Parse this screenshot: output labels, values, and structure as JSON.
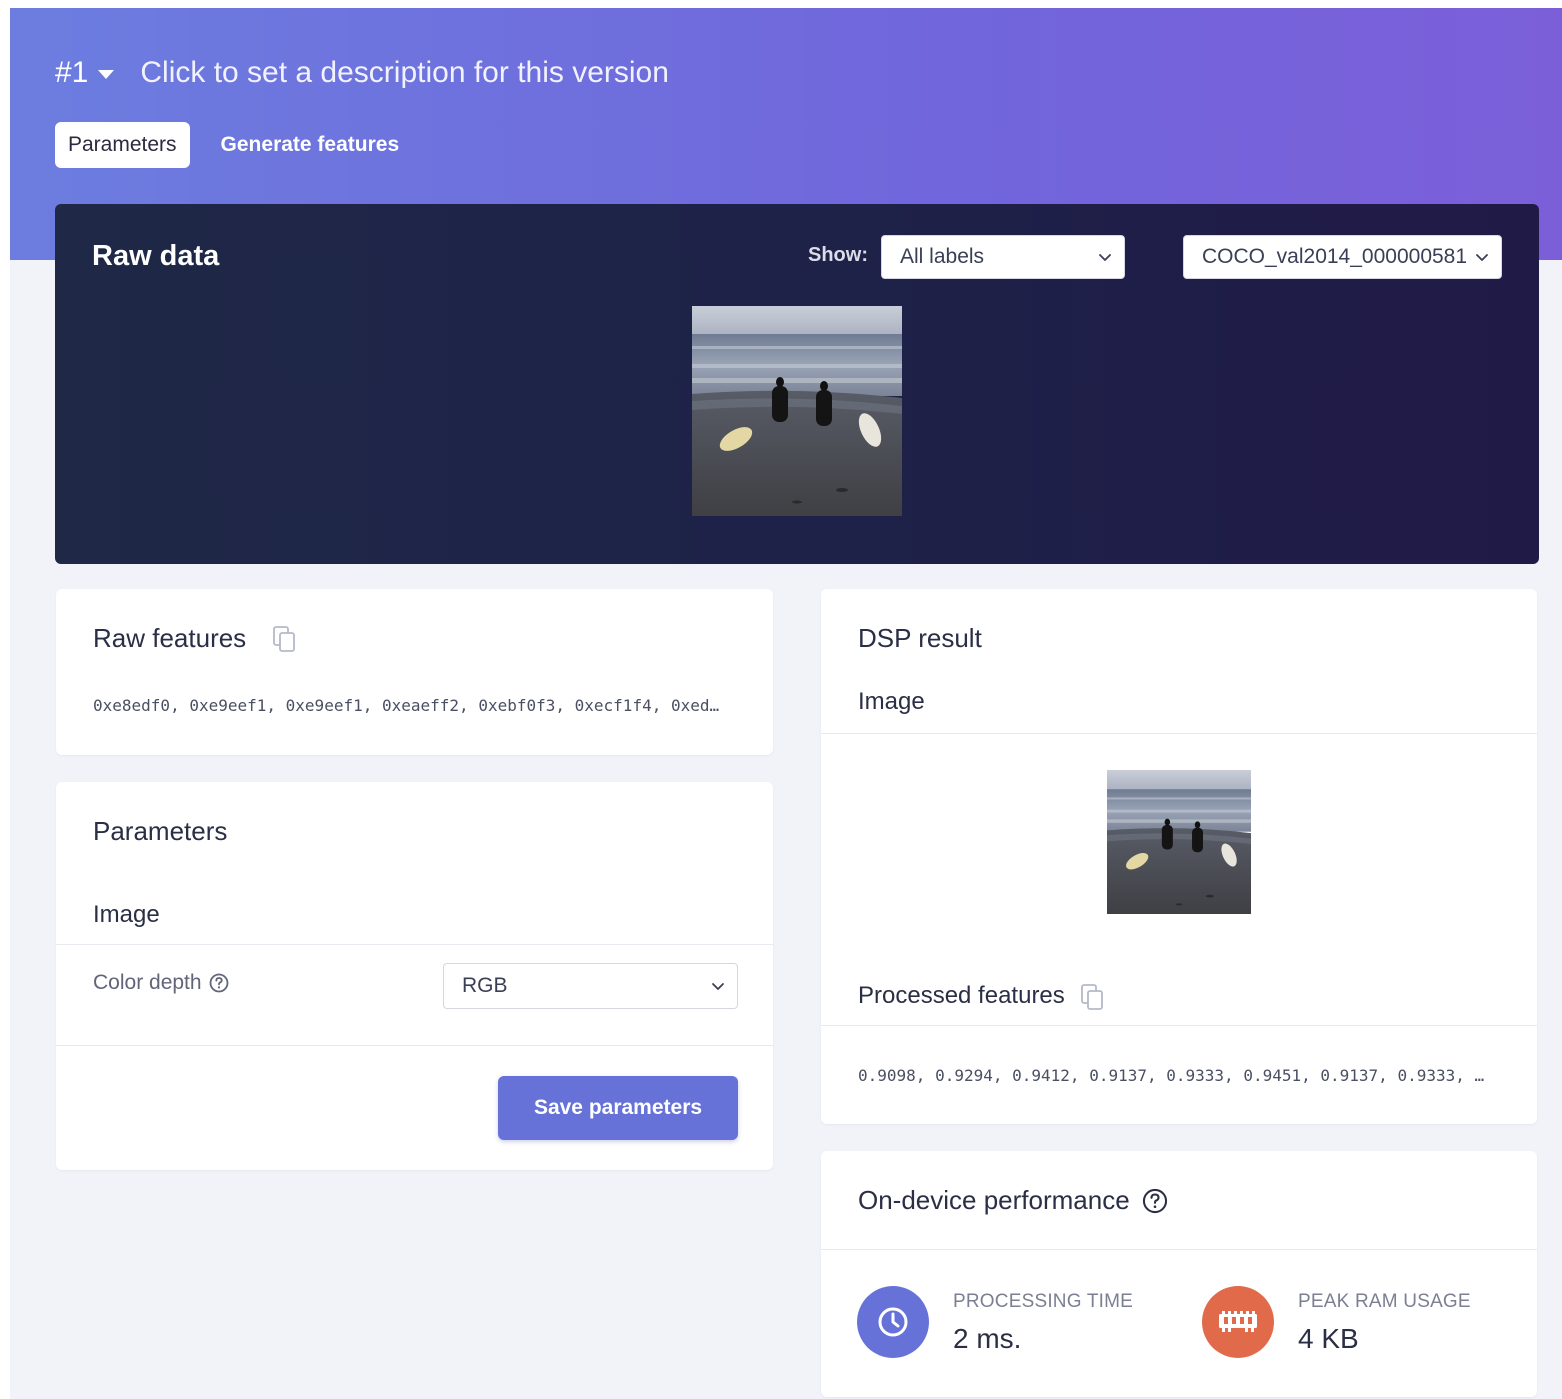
{
  "header": {
    "version": "#1",
    "description_placeholder": "Click to set a description for this version",
    "tabs": [
      {
        "label": "Parameters",
        "active": true
      },
      {
        "label": "Generate features",
        "active": false
      }
    ]
  },
  "raw_data": {
    "title": "Raw data",
    "show_label": "Show:",
    "label_filter": "All labels",
    "sample": "COCO_val2014_000000581"
  },
  "raw_features": {
    "title": "Raw features",
    "values": "0xe8edf0, 0xe9eef1, 0xe9eef1, 0xeaeff2, 0xebf0f3, 0xecf1f4, 0xed…"
  },
  "parameters": {
    "title": "Parameters",
    "section": "Image",
    "color_depth_label": "Color depth",
    "color_depth_value": "RGB",
    "save_label": "Save parameters"
  },
  "dsp_result": {
    "title": "DSP result",
    "section": "Image",
    "processed_title": "Processed features",
    "processed_values": "0.9098, 0.9294, 0.9412, 0.9137, 0.9333, 0.9451, 0.9137, 0.9333, …"
  },
  "performance": {
    "title": "On-device performance",
    "processing_time_label": "PROCESSING TIME",
    "processing_time_value": "2 ms.",
    "peak_ram_label": "PEAK RAM USAGE",
    "peak_ram_value": "4 KB"
  },
  "colors": {
    "accent": "#6772d8",
    "ram_icon": "#e16a4a",
    "time_icon": "#6772d8"
  },
  "icons": {
    "version_dropdown": "caret-down-icon",
    "select": "chevron-down-icon",
    "copy": "copy-icon",
    "help": "help-circle-icon",
    "time": "clock-icon",
    "ram": "memory-chip-icon"
  }
}
